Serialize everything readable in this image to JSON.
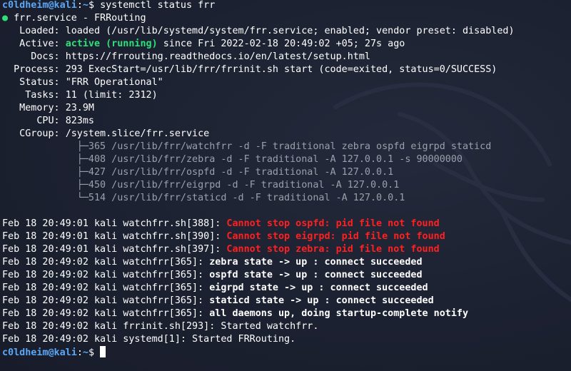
{
  "prompt": {
    "user_host": "c0ldheim@kali",
    "sep": ":",
    "path": "~",
    "sign": "$",
    "command": "systemctl status frr"
  },
  "service": {
    "dot": "●",
    "name": "frr.service - FRRouting",
    "loaded_label": "   Loaded:",
    "loaded_value": "loaded (/usr/lib/systemd/system/frr.service; enabled; vendor preset: disabled)",
    "active_label": "   Active:",
    "active_state": "active (running)",
    "active_since": "since Fri 2022-02-18 20:49:02 +05; 27s ago",
    "docs_label": "     Docs:",
    "docs_value": "https://frrouting.readthedocs.io/en/latest/setup.html",
    "process_label": "  Process:",
    "process_value": "293 ExecStart=/usr/lib/frr/frrinit.sh start (code=exited, status=0/SUCCESS)",
    "status_label": "   Status:",
    "status_value": "\"FRR Operational\"",
    "tasks_label": "    Tasks:",
    "tasks_value": "11 (limit: 2312)",
    "memory_label": "   Memory:",
    "memory_value": "23.9M",
    "cpu_label": "      CPU:",
    "cpu_value": "823ms",
    "cgroup_label": "   CGroup:",
    "cgroup_value": "/system.slice/frr.service"
  },
  "cgroup_tree": [
    "             ├─365 /usr/lib/frr/watchfrr -d -F traditional zebra ospfd eigrpd staticd",
    "             ├─408 /usr/lib/frr/zebra -d -F traditional -A 127.0.0.1 -s 90000000",
    "             ├─427 /usr/lib/frr/ospfd -d -F traditional -A 127.0.0.1",
    "             ├─450 /usr/lib/frr/eigrpd -d -F traditional -A 127.0.0.1",
    "             └─514 /usr/lib/frr/staticd -d -F traditional -A 127.0.0.1"
  ],
  "logs": [
    {
      "prefix": "Feb 18 20:49:01 kali watchfrr.sh[388]: ",
      "message": "Cannot stop ospfd: pid file not found"
    },
    {
      "prefix": "Feb 18 20:49:01 kali watchfrr.sh[390]: ",
      "message": "Cannot stop eigrpd: pid file not found"
    },
    {
      "prefix": "Feb 18 20:49:01 kali watchfrr.sh[397]: ",
      "message": "Cannot stop zebra: pid file not found"
    },
    {
      "prefix": "Feb 18 20:49:02 kali watchfrr[365]: ",
      "message": "zebra state -> up : connect succeeded"
    },
    {
      "prefix": "Feb 18 20:49:02 kali watchfrr[365]: ",
      "message": "ospfd state -> up : connect succeeded"
    },
    {
      "prefix": "Feb 18 20:49:02 kali watchfrr[365]: ",
      "message": "eigrpd state -> up : connect succeeded"
    },
    {
      "prefix": "Feb 18 20:49:02 kali watchfrr[365]: ",
      "message": "staticd state -> up : connect succeeded"
    },
    {
      "prefix": "Feb 18 20:49:02 kali watchfrr[365]: ",
      "message": "all daemons up, doing startup-complete notify"
    },
    {
      "prefix": "Feb 18 20:49:02 kali frrinit.sh[293]: ",
      "message": "Started watchfrr."
    },
    {
      "prefix": "Feb 18 20:49:02 kali systemd[1]: ",
      "message": "Started FRRouting."
    }
  ],
  "prompt2": {
    "user_host": "c0ldheim@kali",
    "sep": ":",
    "path": "~",
    "sign": "$"
  },
  "colors": {
    "background": "#1c2131",
    "prompt_user": "#5ca7f5",
    "active": "#2ee07a",
    "error": "#ff2020",
    "tree": "#9aa0ab"
  }
}
